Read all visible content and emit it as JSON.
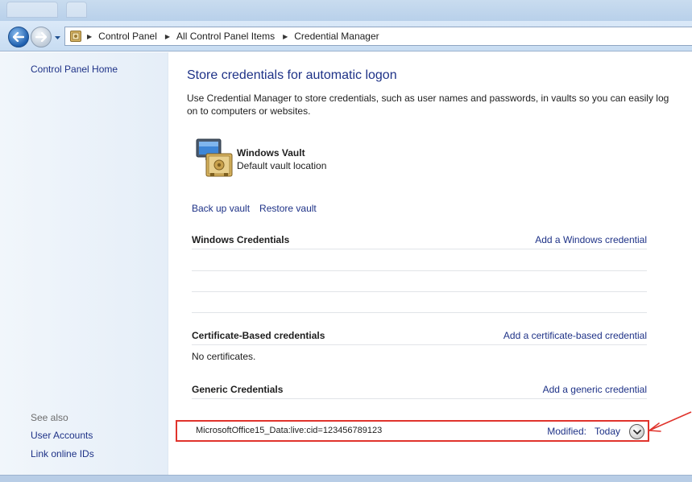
{
  "breadcrumb": {
    "items": [
      "Control Panel",
      "All Control Panel Items",
      "Credential Manager"
    ]
  },
  "sidebar": {
    "home": "Control Panel Home",
    "see_also_label": "See also",
    "see_also_items": [
      "User Accounts",
      "Link online IDs"
    ]
  },
  "main": {
    "title": "Store credentials for automatic logon",
    "description": "Use Credential Manager to store credentials, such as user names and passwords, in vaults so you can easily log on to computers or websites.",
    "vault": {
      "name": "Windows Vault",
      "description": "Default vault location",
      "icon": "vault-safe-icon"
    },
    "vault_actions": {
      "backup": "Back up vault",
      "restore": "Restore vault"
    },
    "sections": {
      "windows": {
        "title": "Windows Credentials",
        "add_link": "Add a Windows credential"
      },
      "certificate": {
        "title": "Certificate-Based credentials",
        "add_link": "Add a certificate-based credential",
        "empty_text": "No certificates."
      },
      "generic": {
        "title": "Generic Credentials",
        "add_link": "Add a generic credential",
        "items": [
          {
            "name": "MicrosoftOffice15_Data:live:cid=123456789123",
            "modified_label": "Modified:",
            "modified_value": "Today"
          }
        ]
      }
    }
  },
  "colors": {
    "link": "#1e3287",
    "highlight_border": "#e0332c"
  }
}
